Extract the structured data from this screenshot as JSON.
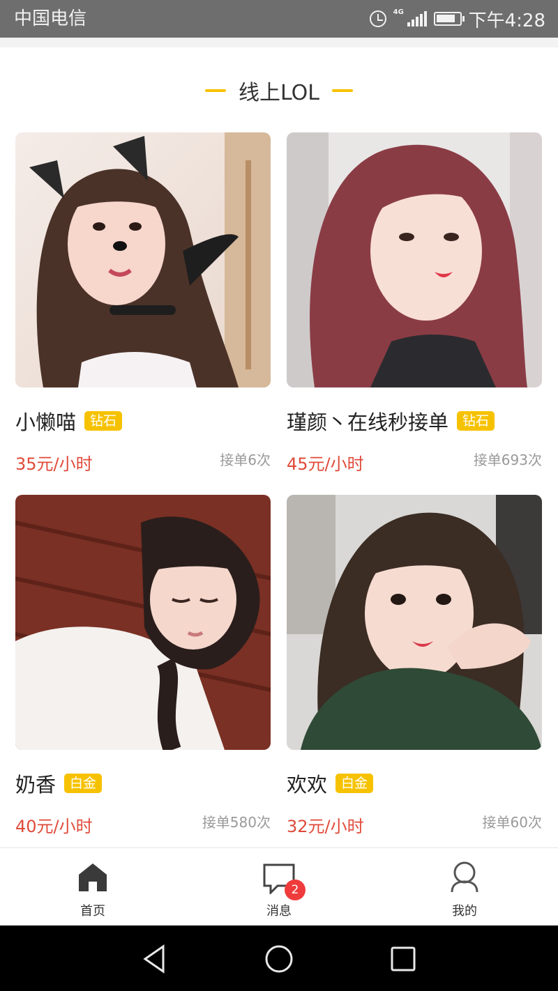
{
  "status_bar": {
    "carrier": "中国电信",
    "network": "4G",
    "time": "下午4:28"
  },
  "section": {
    "title": "线上LOL"
  },
  "cards": [
    {
      "name": "小懒喵",
      "tier": "钻石",
      "price": "35元/小时",
      "orders": "接单6次"
    },
    {
      "name": "瑾颜丶在线秒接单",
      "tier": "钻石",
      "price": "45元/小时",
      "orders": "接单693次"
    },
    {
      "name": "奶香",
      "tier": "白金",
      "price": "40元/小时",
      "orders": "接单580次"
    },
    {
      "name": "欢欢",
      "tier": "白金",
      "price": "32元/小时",
      "orders": "接单60次"
    }
  ],
  "bottom_nav": {
    "items": [
      {
        "label": "首页",
        "icon": "home-icon",
        "active": true
      },
      {
        "label": "消息",
        "icon": "message-icon",
        "badge": "2"
      },
      {
        "label": "我的",
        "icon": "profile-icon"
      }
    ]
  },
  "colors": {
    "accent": "#f6c200",
    "price": "#e04a3a",
    "badge": "#ef3b3b",
    "status_bar": "#6e6e6e"
  },
  "android_nav": {
    "icons": [
      "back-icon",
      "home-circle-icon",
      "recents-icon"
    ]
  }
}
